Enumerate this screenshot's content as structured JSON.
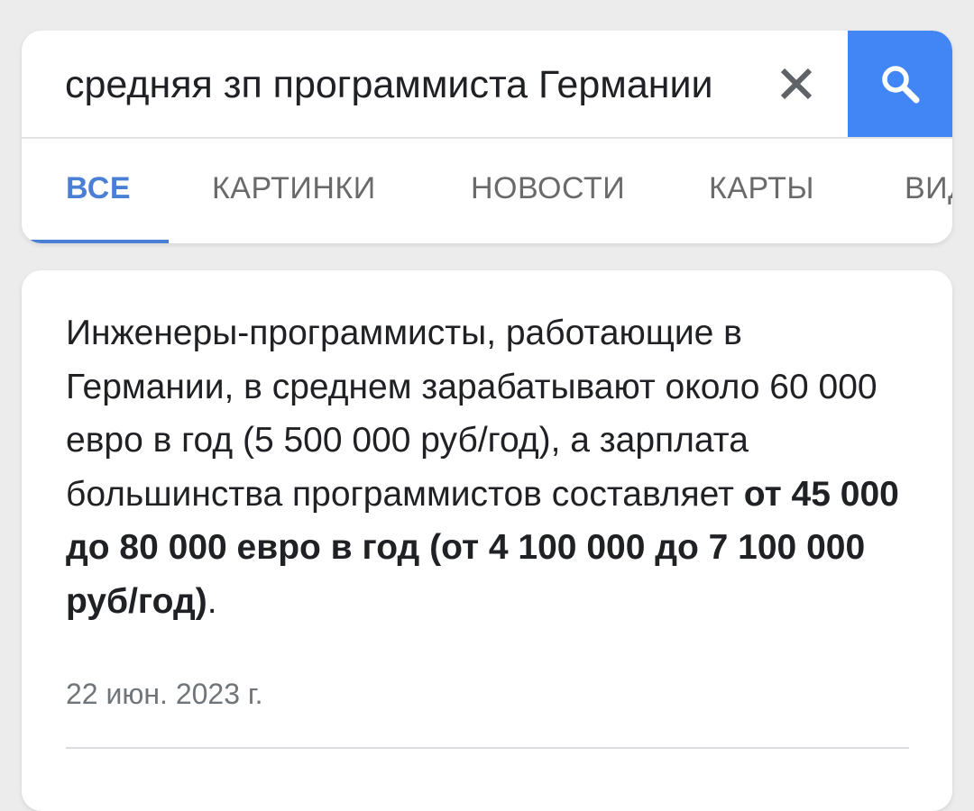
{
  "search": {
    "query": "средняя зп программиста Германии",
    "clear_icon": "close-icon",
    "submit_icon": "search-icon",
    "accent_color": "#4285f4"
  },
  "tabs": [
    {
      "label": "ВСЕ",
      "active": true
    },
    {
      "label": "КАРТИНКИ",
      "active": false
    },
    {
      "label": "НОВОСТИ",
      "active": false
    },
    {
      "label": "КАРТЫ",
      "active": false
    },
    {
      "label": "ВИД",
      "active": false
    }
  ],
  "result": {
    "snippet_plain": "Инженеры-программисты, работающие в Германии, в среднем зарабатывают около 60 000 евро в год (5 500 000 руб/год), а зарплата большинства программистов составляет ",
    "snippet_bold": "от 45 000 до 80 000 евро в год (от 4 100 000 до 7 100 000 руб/год)",
    "snippet_end": ".",
    "date": "22 июн. 2023 г."
  }
}
